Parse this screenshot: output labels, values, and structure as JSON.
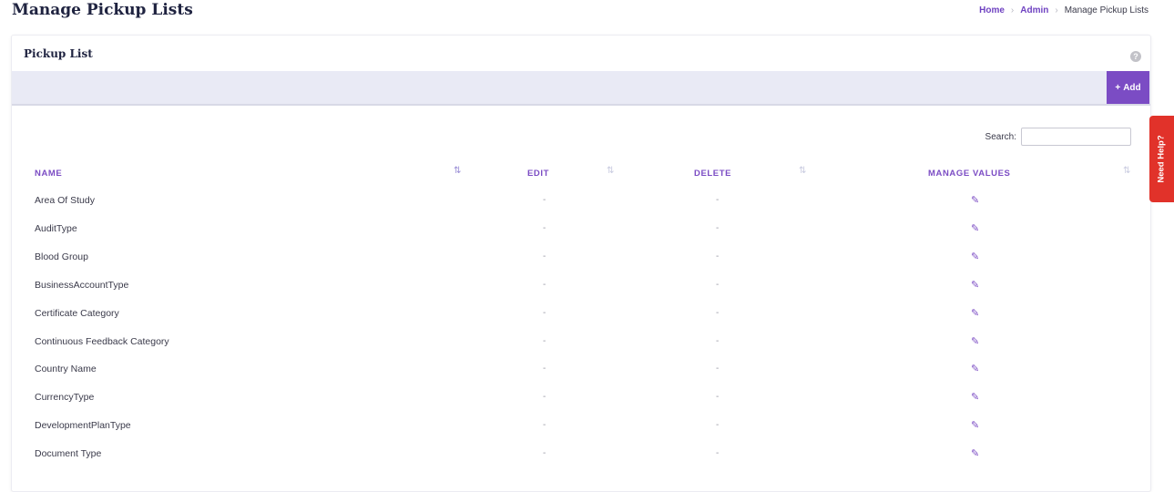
{
  "page": {
    "title": "Manage Pickup Lists"
  },
  "breadcrumb": {
    "home": "Home",
    "admin": "Admin",
    "current": "Manage Pickup Lists",
    "separator": "›"
  },
  "card": {
    "title": "Pickup List",
    "help_glyph": "?",
    "help_icon": "question-circle-icon"
  },
  "toolbar": {
    "add_label": "Add",
    "add_icon_glyph": "+"
  },
  "search": {
    "label": "Search:",
    "value": "",
    "placeholder": ""
  },
  "table": {
    "columns": [
      "NAME",
      "EDIT",
      "DELETE",
      "MANAGE VALUES"
    ],
    "sort_glyph": "⇅",
    "rows": [
      {
        "name": "Area Of Study",
        "edit": "-",
        "delete": "-"
      },
      {
        "name": "AuditType",
        "edit": "-",
        "delete": "-"
      },
      {
        "name": "Blood Group",
        "edit": "-",
        "delete": "-"
      },
      {
        "name": "BusinessAccountType",
        "edit": "-",
        "delete": "-"
      },
      {
        "name": "Certificate Category",
        "edit": "-",
        "delete": "-"
      },
      {
        "name": "Continuous Feedback Category",
        "edit": "-",
        "delete": "-"
      },
      {
        "name": "Country Name",
        "edit": "-",
        "delete": "-"
      },
      {
        "name": "CurrencyType",
        "edit": "-",
        "delete": "-"
      },
      {
        "name": "DevelopmentPlanType",
        "edit": "-",
        "delete": "-"
      },
      {
        "name": "Document Type",
        "edit": "-",
        "delete": "-"
      }
    ],
    "manage_icon_glyph": "✎"
  },
  "need_help": {
    "label": "Need Help?"
  },
  "colors": {
    "accent": "#7b4cc4",
    "title": "#1f2340",
    "help_tab": "#e1322a",
    "toolbar_bg": "#e9eaf5"
  }
}
